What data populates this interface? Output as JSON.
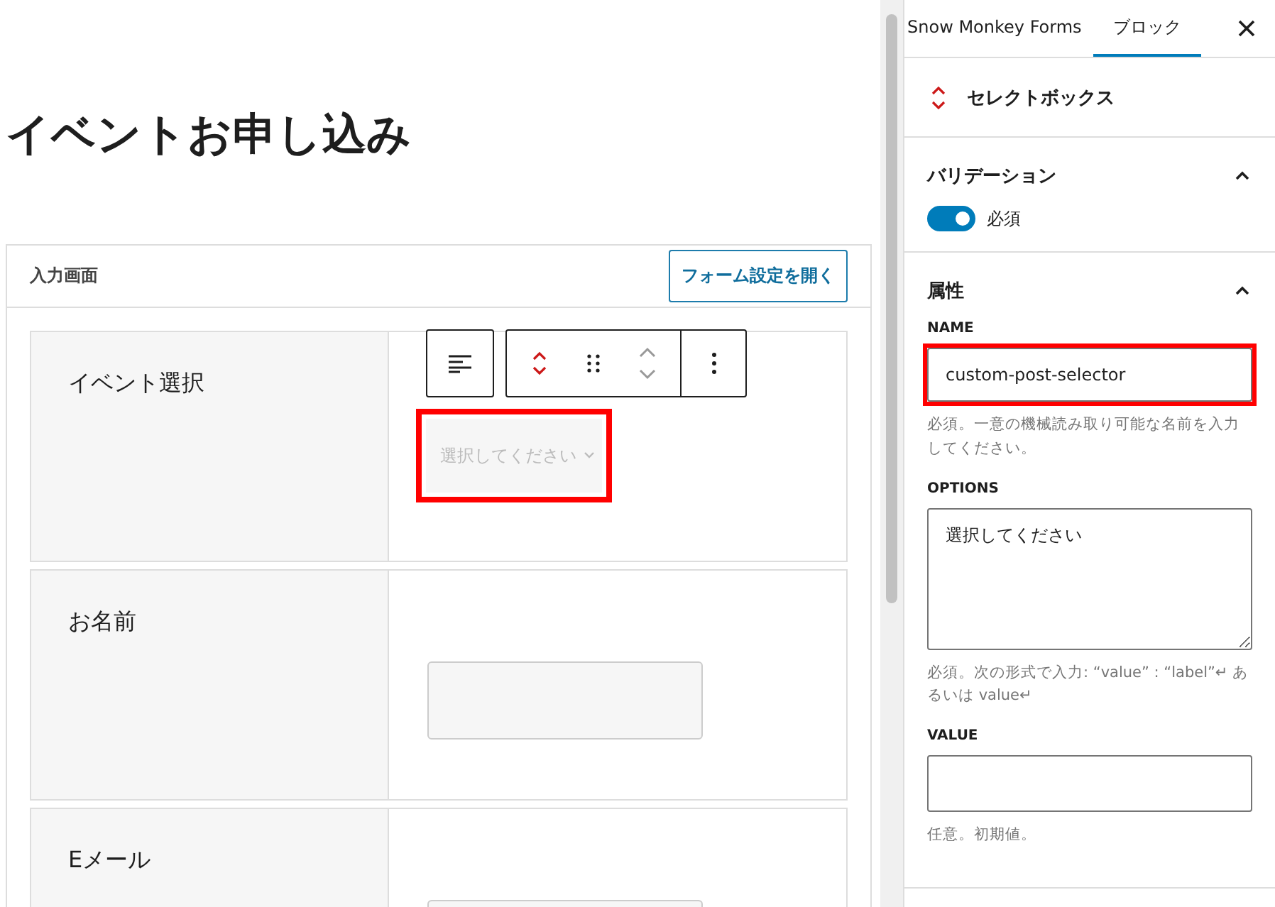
{
  "editor": {
    "title": "イベントお申し込み",
    "panel": {
      "title": "入力画面",
      "button": "フォーム設定を開く"
    },
    "fields": [
      {
        "label": "イベント選択",
        "kind": "select",
        "placeholder": "選択してください",
        "selected": true
      },
      {
        "label": "お名前",
        "kind": "text",
        "selected": false
      },
      {
        "label": "Eメール",
        "kind": "text",
        "selected": false
      }
    ]
  },
  "sidebar": {
    "tabs": [
      {
        "label": "Snow Monkey Forms",
        "selected": false
      },
      {
        "label": "ブロック",
        "selected": true
      }
    ],
    "block": {
      "name": "セレクトボックス"
    },
    "sections": [
      {
        "title": "バリデーション",
        "expanded": true,
        "toggles": [
          {
            "label": "必須",
            "on": true
          }
        ]
      },
      {
        "title": "属性",
        "expanded": true,
        "controls": [
          {
            "kind": "input",
            "label": "NAME",
            "value": "custom-post-selector",
            "highlighted": true,
            "help": "必須。一意の機械読み取り可能な名前を入力してください。"
          },
          {
            "kind": "textarea",
            "label": "OPTIONS",
            "value": "選択してください",
            "highlighted": false,
            "help": "必須。次の形式で入力: “value” : “label”↵ あるいは value↵"
          },
          {
            "kind": "input",
            "label": "VALUE",
            "highlighted": false,
            "help": "任意。初期値。"
          }
        ]
      }
    ]
  }
}
